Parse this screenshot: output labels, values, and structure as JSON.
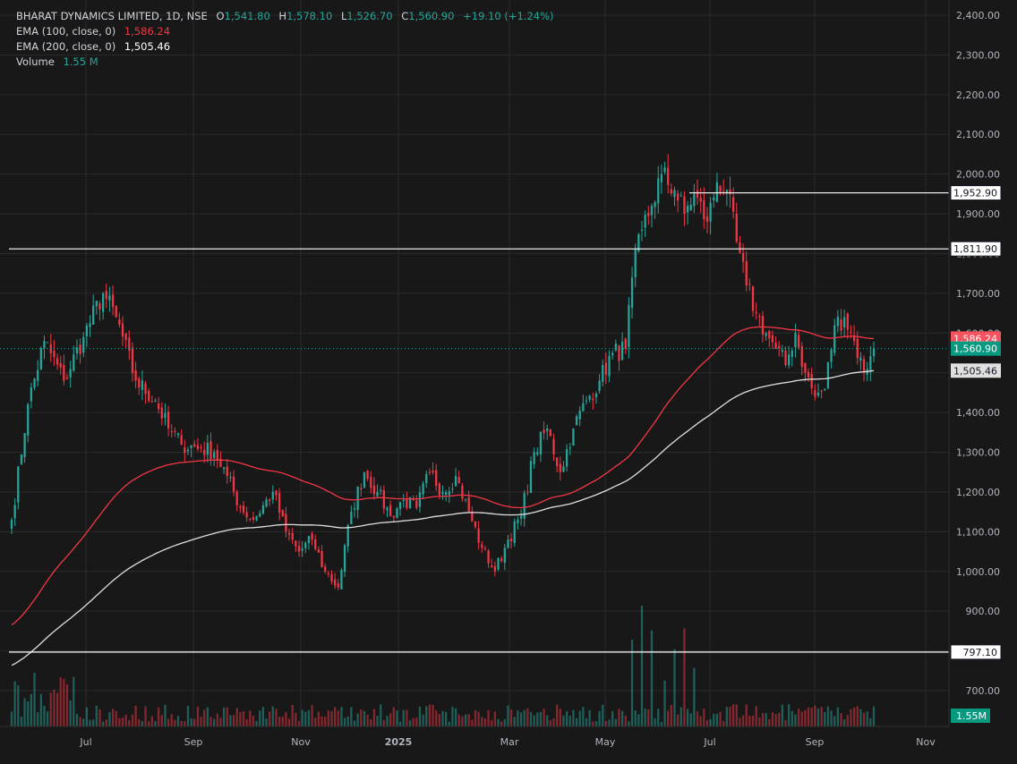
{
  "legend": {
    "symbol": "BHARAT DYNAMICS LIMITED, 1D, NSE",
    "o_label": "O",
    "o_value": "1,541.80",
    "h_label": "H",
    "h_value": "1,578.10",
    "l_label": "L",
    "l_value": "1,526.70",
    "c_label": "C",
    "c_value": "1,560.90",
    "change": "+19.10 (+1.24%)",
    "ema100_label": "EMA (100, close, 0)",
    "ema100_value": "1,586.24",
    "ema200_label": "EMA (200, close, 0)",
    "ema200_value": "1,505.46",
    "volume_label": "Volume",
    "volume_value": "1.55 M"
  },
  "colors": {
    "background": "#181818",
    "grid": "#2a2a2a",
    "up": "#26a69a",
    "down": "#f23645",
    "ema100": "#f23645",
    "ema200": "#e0e0e0",
    "text": "#b2b5be",
    "hline": "#ffffff"
  },
  "chart_data": {
    "type": "candlestick",
    "ylim": [
      680,
      2420
    ],
    "y_ticks": [
      "2,400.00",
      "2,300.00",
      "2,200.00",
      "2,100.00",
      "2,000.00",
      "1,900.00",
      "1,800.00",
      "1,700.00",
      "1,600.00",
      "1,500.00",
      "1,400.00",
      "1,300.00",
      "1,200.00",
      "1,100.00",
      "1,000.00",
      "900.00",
      "800.00",
      "700.00"
    ],
    "y_tick_values": [
      2400,
      2300,
      2200,
      2100,
      2000,
      1900,
      1800,
      1700,
      1600,
      1500,
      1400,
      1300,
      1200,
      1100,
      1000,
      900,
      800,
      700
    ],
    "x_ticks": [
      "Jul",
      "Sep",
      "Nov",
      "2025",
      "Mar",
      "May",
      "Jul",
      "Sep",
      "Nov"
    ],
    "grid": true,
    "last_close": 1560.9,
    "ema100_last": 1586.24,
    "ema200_last": 1505.46,
    "volume_last": "1.55M",
    "horizontal_lines": [
      {
        "value": 1952.9,
        "label": "1,952.90"
      },
      {
        "value": 1811.9,
        "label": "1,811.90"
      },
      {
        "value": 797.1,
        "label": "797.10"
      }
    ],
    "price_labels": [
      {
        "value": 1586.24,
        "label": "1,586.24",
        "kind": "ema100"
      },
      {
        "value": 1560.9,
        "label": "1,560.90",
        "kind": "last"
      },
      {
        "value": 1505.46,
        "label": "1,505.46",
        "kind": "ema200"
      }
    ],
    "close_anchors": [
      [
        0,
        1130
      ],
      [
        5,
        1420
      ],
      [
        10,
        1580
      ],
      [
        16,
        1480
      ],
      [
        22,
        1590
      ],
      [
        28,
        1700
      ],
      [
        32,
        1640
      ],
      [
        38,
        1480
      ],
      [
        44,
        1430
      ],
      [
        48,
        1360
      ],
      [
        52,
        1320
      ],
      [
        58,
        1310
      ],
      [
        62,
        1300
      ],
      [
        66,
        1240
      ],
      [
        70,
        1160
      ],
      [
        74,
        1130
      ],
      [
        80,
        1200
      ],
      [
        84,
        1100
      ],
      [
        88,
        1050
      ],
      [
        92,
        1080
      ],
      [
        96,
        1000
      ],
      [
        100,
        960
      ],
      [
        104,
        1150
      ],
      [
        108,
        1250
      ],
      [
        112,
        1200
      ],
      [
        116,
        1140
      ],
      [
        120,
        1180
      ],
      [
        124,
        1160
      ],
      [
        128,
        1250
      ],
      [
        132,
        1200
      ],
      [
        136,
        1240
      ],
      [
        140,
        1150
      ],
      [
        144,
        1060
      ],
      [
        148,
        1000
      ],
      [
        152,
        1080
      ],
      [
        156,
        1140
      ],
      [
        160,
        1300
      ],
      [
        164,
        1360
      ],
      [
        168,
        1250
      ],
      [
        172,
        1360
      ],
      [
        176,
        1430
      ],
      [
        180,
        1480
      ],
      [
        184,
        1550
      ],
      [
        188,
        1560
      ],
      [
        190,
        1740
      ],
      [
        193,
        1860
      ],
      [
        196,
        1920
      ],
      [
        199,
        2000
      ],
      [
        203,
        1960
      ],
      [
        206,
        1900
      ],
      [
        209,
        1950
      ],
      [
        213,
        1880
      ],
      [
        216,
        1980
      ],
      [
        219,
        1960
      ],
      [
        222,
        1830
      ],
      [
        225,
        1720
      ],
      [
        228,
        1650
      ],
      [
        231,
        1600
      ],
      [
        234,
        1560
      ],
      [
        237,
        1520
      ],
      [
        240,
        1600
      ],
      [
        243,
        1500
      ],
      [
        246,
        1440
      ],
      [
        249,
        1460
      ],
      [
        252,
        1620
      ],
      [
        255,
        1640
      ],
      [
        258,
        1580
      ],
      [
        261,
        1500
      ],
      [
        263,
        1541.8
      ],
      [
        264,
        1560.9
      ]
    ]
  }
}
